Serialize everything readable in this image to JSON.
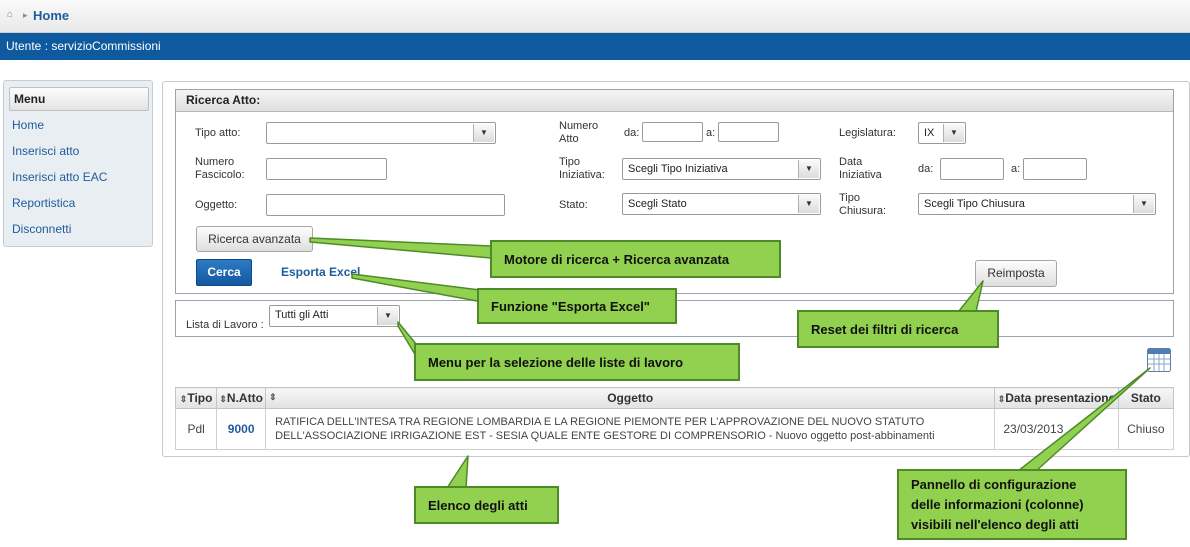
{
  "breadcrumb": {
    "current": "Home"
  },
  "user": {
    "label": "Utente : servizioCommissioni"
  },
  "menu": {
    "title": "Menu",
    "items": [
      "Home",
      "Inserisci atto",
      "Inserisci atto EAC",
      "Reportistica",
      "Disconnetti"
    ]
  },
  "search": {
    "title": "Ricerca Atto:",
    "tipo_atto": {
      "label": "Tipo atto:",
      "value": ""
    },
    "numero_atto": {
      "label_1": "Numero",
      "label_2": "Atto",
      "da": "da:",
      "a": "a:"
    },
    "legislatura": {
      "label": "Legislatura:",
      "value": "IX"
    },
    "numero_fascicolo": {
      "label_1": "Numero",
      "label_2": "Fascicolo:"
    },
    "tipo_iniziativa": {
      "label_1": "Tipo",
      "label_2": "Iniziativa:",
      "value": "Scegli Tipo Iniziativa"
    },
    "data_iniziativa": {
      "label_1": "Data",
      "label_2": "Iniziativa",
      "da": "da:",
      "a": "a:"
    },
    "oggetto": {
      "label": "Oggetto:"
    },
    "stato": {
      "label": "Stato:",
      "value": "Scegli Stato"
    },
    "tipo_chiusura": {
      "label_1": "Tipo",
      "label_2": "Chiusura:",
      "value": "Scegli Tipo Chiusura"
    },
    "advanced_button": "Ricerca avanzata",
    "search_button": "Cerca",
    "export_link": "Esporta Excel",
    "reset_button": "Reimposta"
  },
  "worklist": {
    "label": "Lista di Lavoro :",
    "value": "Tutti gli Atti"
  },
  "table": {
    "columns": [
      "Tipo",
      "N.Atto",
      "",
      "Oggetto",
      "Data presentazione",
      "Stato"
    ],
    "rows": [
      {
        "tipo": "Pdl",
        "n_atto": "9000",
        "oggetto_1": "RATIFICA DELL'INTESA TRA REGIONE LOMBARDIA E LA REGIONE PIEMONTE PER L'APPROVAZIONE DEL NUOVO STATUTO",
        "oggetto_2": "DELL'ASSOCIAZIONE IRRIGAZIONE EST - SESIA QUALE ENTE GESTORE DI COMPRENSORIO - Nuovo oggetto post-abbinamenti",
        "data_presentazione": "23/03/2013",
        "stato": "Chiuso"
      }
    ]
  },
  "callouts": {
    "search_engine": "Motore di ricerca + Ricerca avanzata",
    "export": "Funzione \"Esporta Excel\"",
    "reset": "Reset dei filtri di ricerca",
    "worklists": "Menu per la selezione delle liste di lavoro",
    "list": "Elenco degli atti",
    "columns_panel_1": "Pannello di configurazione",
    "columns_panel_2": "delle informazioni (colonne)",
    "columns_panel_3": "visibili nell'elenco degli atti"
  },
  "colors": {
    "brand_blue": "#0f5a9e",
    "callout_green": "#92d050",
    "callout_border": "#4e8a2a"
  },
  "icons": [
    "home-icon",
    "chevron-right-icon",
    "chevron-down-icon",
    "sort-icon",
    "table-columns-icon"
  ]
}
